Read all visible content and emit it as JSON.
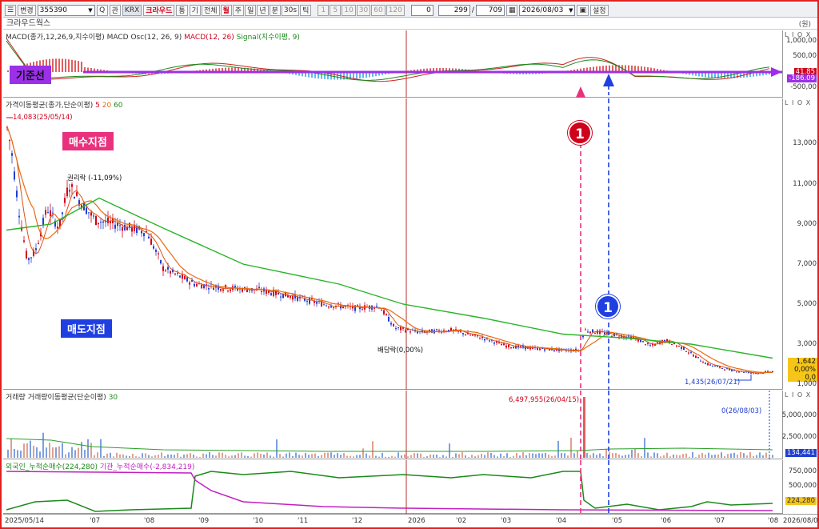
{
  "toolbar": {
    "mode_label": "변경",
    "code_value": "355390",
    "name_label": "크라우드",
    "flag_label": "통",
    "period_buttons": [
      "기",
      "전체",
      "월",
      "주",
      "일",
      "년",
      "분",
      "30s",
      "틱"
    ],
    "num_buttons": [
      "1",
      "5",
      "10",
      "30",
      "60",
      "120"
    ],
    "counter_value": "0",
    "count_a": "299",
    "count_b": "709",
    "date_value": "2026/08/03",
    "settings_label": "설정",
    "kr_badge": "KRX",
    "fx_label": "관"
  },
  "window_title": "크라우드웍스",
  "unit_label": "(원)",
  "macd_panel": {
    "label_main": "MACD(종가,12,26,9,지수이평) MACD Osc(12, 26, 9)",
    "label_red": "MACD(12, 26)",
    "label_green": "Signal(지수이평, 9)",
    "ticks": [
      "1,000,00",
      "500,00",
      "0,00",
      "-500,00"
    ],
    "badge_red": "41.85",
    "badge_purple": "-186.09",
    "baseline_label": "기준선",
    "lio": "L I O X"
  },
  "price_panel": {
    "label_main": "가격이동평균(종가,단순이평)",
    "ma_a": "5",
    "ma_b": "20",
    "ma_c": "60",
    "ticks": [
      "13,000",
      "11,000",
      "9,000",
      "7,000",
      "5,000",
      "3,000",
      "1,000"
    ],
    "max_label": "14,083(25/05/14)",
    "annot_rights": "권리락 (-11,09%)",
    "annot_div": "배당락(0,00%)",
    "min_label": "1,435(26/07/21)",
    "buy_label": "매수지점",
    "sell_label": "매도지점",
    "marker_buy": "1",
    "marker_sell": "1",
    "last_price": "1,642",
    "last_change": "0,00%",
    "last_zero": "0,0",
    "lio": "L I O X",
    "colors": {
      "ma5": "#e05010",
      "ma20": "#e86a10",
      "ma60": "#28b428",
      "up": "#d0021b",
      "down": "#1f3fd0"
    }
  },
  "volume_panel": {
    "label_main": "거래량",
    "label_ma": "거래량이동평균(단순이평)",
    "ma_period": "30",
    "ticks": [
      "5,000,000",
      "2,500,000"
    ],
    "max_label": "6,497,955(26/04/15)",
    "last_label": "0(26/08/03)",
    "last_value": "134,441",
    "lio": "L I O X"
  },
  "flow_panel": {
    "label_foreign": "외국인_누적순매수(224,280)",
    "label_inst": "기관_누적순매수(-2,834,219)",
    "ticks": [
      "750,000",
      "500,000",
      "250,000"
    ],
    "last_value": "224,280"
  },
  "date_axis": [
    "2025/05/14",
    "'07",
    "'08",
    "'09",
    "'10",
    "'11",
    "'12",
    "2026",
    "'02",
    "'03",
    "'04",
    "'05",
    "'06",
    "'07",
    "'08",
    "2026/08/03"
  ]
}
